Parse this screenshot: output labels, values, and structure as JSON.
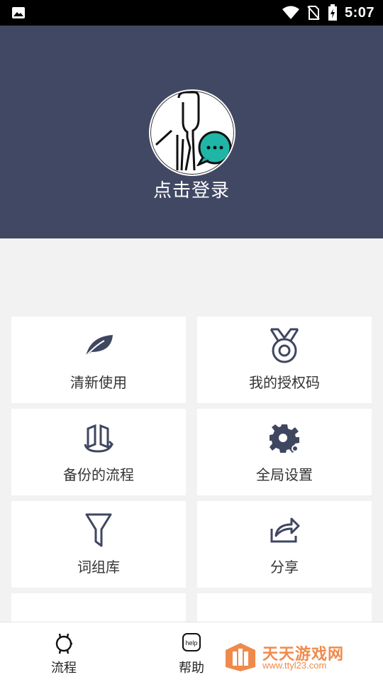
{
  "status_bar": {
    "time": "5:07"
  },
  "header": {
    "login_label": "点击登录"
  },
  "tiles": [
    {
      "label": "清新使用",
      "icon": "leaf-icon"
    },
    {
      "label": "我的授权码",
      "icon": "medal-icon"
    },
    {
      "label": "备份的流程",
      "icon": "backup-icon"
    },
    {
      "label": "全局设置",
      "icon": "gear-icon"
    },
    {
      "label": "词组库",
      "icon": "filter-icon"
    },
    {
      "label": "分享",
      "icon": "share-icon"
    }
  ],
  "bottom_nav": [
    {
      "label": "流程",
      "icon": "watch-icon"
    },
    {
      "label": "帮助",
      "icon": "help-icon",
      "icon_text": "help"
    }
  ],
  "watermark": {
    "title": "天天游戏网",
    "url": "www.ttyl23.com"
  },
  "colors": {
    "header_bg": "#414863",
    "icon": "#3f4660",
    "chat_bubble": "#1fb6a8",
    "watermark": "#f08a4b"
  }
}
